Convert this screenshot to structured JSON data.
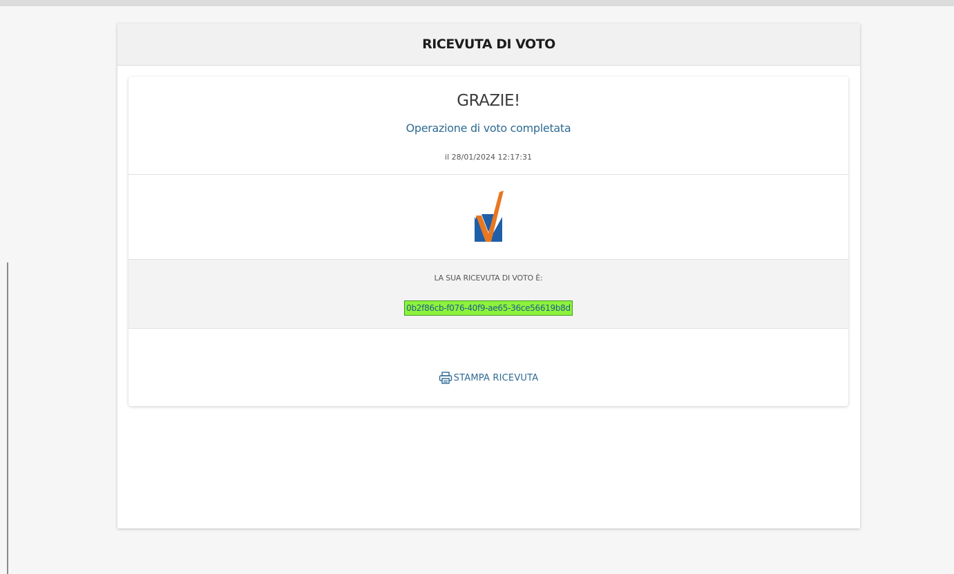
{
  "header": {
    "title": "RICEVUTA DI VOTO"
  },
  "thanks": {
    "title": "GRAZIE!",
    "subtitle": "Operazione di voto completata",
    "timestamp": "il 28/01/2024 12:17:31"
  },
  "logo": {
    "icon": "vote-check-logo",
    "colors": {
      "check": "#e87722",
      "box": "#1f5fa8"
    }
  },
  "receipt": {
    "label": "LA SUA RICEVUTA DI VOTO È:",
    "code": "0b2f86cb-f076-40f9-ae65-36ce56619b8d",
    "highlight_color": "#8cf23c"
  },
  "actions": {
    "print_icon": "printer-icon",
    "print_label": "STAMPA RICEVUTA"
  },
  "colors": {
    "accent": "#2f6a93",
    "header_bg": "#f1f1f1",
    "page_bg": "#f6f6f7"
  }
}
